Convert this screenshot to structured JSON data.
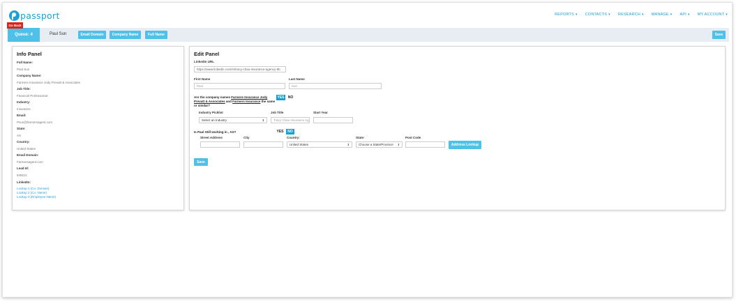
{
  "brand": {
    "name": "passport"
  },
  "nav": {
    "items": [
      {
        "label": "REPORTS"
      },
      {
        "label": "CONTACTS"
      },
      {
        "label": "RESEARCH"
      },
      {
        "label": "MANAGE"
      },
      {
        "label": "API"
      },
      {
        "label": "MY ACCOUNT"
      }
    ]
  },
  "toolbar": {
    "go_back": "Go Back",
    "queue": "Queue: 4",
    "person": "Paul Sun",
    "email_domain": "Email Domain",
    "company_name": "Company Name",
    "full_name": "Full Name",
    "save": "Save"
  },
  "info": {
    "title": "Info Panel",
    "full_name_label": "Full Name:",
    "full_name": "Paul Sun",
    "company_label": "Company Name:",
    "company": "Farmers Insurance Jody Prevatt & Associates",
    "job_title_label": "Job Title:",
    "job_title": "Financial Professional",
    "industry_label": "Industry:",
    "industry": "Insurance",
    "email_label": "Email:",
    "email": "Psun@farmersagent.com",
    "state_label": "State:",
    "state": "AS",
    "country_label": "Country:",
    "country": "United States",
    "email_domain_label": "Email Domain:",
    "email_domain": "Farmersagent.com",
    "lead_id_label": "Lead Id:",
    "lead_id": "949112",
    "linkedin_label": "LinkedIn:",
    "lookups": [
      "Lookup 1 (Co. Domain)",
      "Lookup 2 (Co. Name)",
      "Lookup 3 (Employee Name)"
    ]
  },
  "edit": {
    "title": "Edit Panel",
    "linkedin_label": "LinkedIn URL",
    "linkedin_value": "https://www.linkedin.com/in/tracy-chau-insurance-agency-9b",
    "first_name_label": "First Name",
    "first_name_placeholder": "Paul",
    "last_name_label": "Last Name",
    "last_name_placeholder": "Sun",
    "company_q": {
      "prefix": "Are the company names ",
      "name1": "Farmers Insurance Jody Prevatt & Associates",
      "mid": " and ",
      "name2": "Farmers Insurance",
      "suffix": " the same or similar?"
    },
    "yes": "YES",
    "no": "NO",
    "industry_label": "Industry Picklist",
    "industry_select": "Select an Industry",
    "job_title_label": "Job Title",
    "job_title_placeholder": "Tracy Chau Insurance Ag",
    "start_year_label": "Start Year",
    "working_q": "Is Paul Still working in , AS?",
    "street_label": "Street Address",
    "city_label": "City",
    "country_label": "Country:",
    "country_select": "United States",
    "state_label": "State:",
    "state_select": "Choose a State/Province",
    "postcode_label": "Post Code",
    "address_lookup": "Address Lookup",
    "save": "Save"
  }
}
